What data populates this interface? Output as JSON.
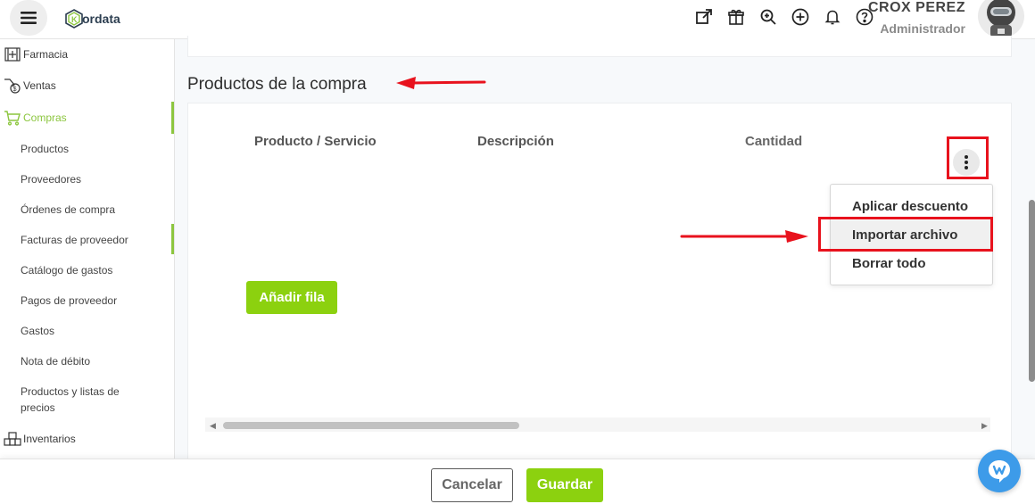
{
  "header": {
    "brand": "ordata",
    "user_name": "CROX PEREZ",
    "user_role": "Administrador",
    "icons": [
      "external-link-icon",
      "gift-icon",
      "search-zoom-icon",
      "add-circle-icon",
      "bell-icon",
      "help-icon"
    ]
  },
  "sidebar": {
    "items": [
      {
        "label": "Farmacia",
        "icon": "pharmacy-icon"
      },
      {
        "label": "Ventas",
        "icon": "sales-tag-icon"
      },
      {
        "label": "Compras",
        "icon": "cart-icon"
      },
      {
        "label": "Inventarios",
        "icon": "warehouse-icon"
      }
    ],
    "sub_items": [
      "Productos",
      "Proveedores",
      "Órdenes de compra",
      "Facturas de proveedor",
      "Catálogo de gastos",
      "Pagos de proveedor",
      "Gastos",
      "Nota de débito",
      "Productos y listas de precios"
    ]
  },
  "main": {
    "section_title": "Productos de la compra",
    "columns": [
      "Producto / Servicio",
      "Descripción",
      "Cantidad"
    ],
    "add_row_label": "Añadir fila",
    "menu": {
      "items": [
        "Aplicar descuento",
        "Importar archivo",
        "Borrar todo"
      ],
      "highlighted": "Importar archivo"
    }
  },
  "footer": {
    "cancel_label": "Cancelar",
    "save_label": "Guardar"
  },
  "colors": {
    "accent_green": "#8cd10f",
    "annotation_red": "#e8121d",
    "chat_blue": "#3d9be9"
  }
}
